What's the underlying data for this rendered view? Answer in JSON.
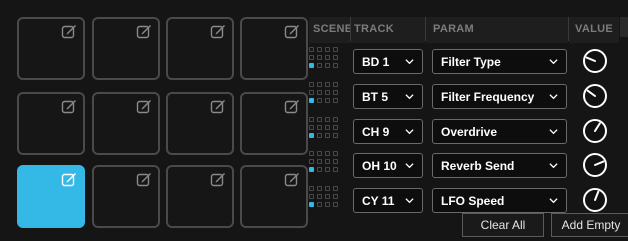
{
  "headers": {
    "scene": "SCENE",
    "track": "TRACK",
    "param": "PARAM",
    "value": "VALUE"
  },
  "pads": [
    {
      "active": false
    },
    {
      "active": false
    },
    {
      "active": false
    },
    {
      "active": false
    },
    {
      "active": false
    },
    {
      "active": false
    },
    {
      "active": false
    },
    {
      "active": false
    },
    {
      "active": true
    },
    {
      "active": false
    },
    {
      "active": false
    },
    {
      "active": false
    }
  ],
  "rows": [
    {
      "track": "BD 1",
      "param": "Filter Type",
      "value": 0.25
    },
    {
      "track": "BT 5",
      "param": "Filter Frequency",
      "value": 0.3
    },
    {
      "track": "CH 9",
      "param": "Overdrive",
      "value": 0.62
    },
    {
      "track": "OH 10",
      "param": "Reverb Send",
      "value": 0.75
    },
    {
      "track": "CY 11",
      "param": "LFO Speed",
      "value": 0.58
    }
  ],
  "buttons": {
    "clear_all": "Clear All",
    "add_empty": "Add Empty"
  },
  "colors": {
    "accent": "#34b9e6",
    "background": "#151515"
  }
}
